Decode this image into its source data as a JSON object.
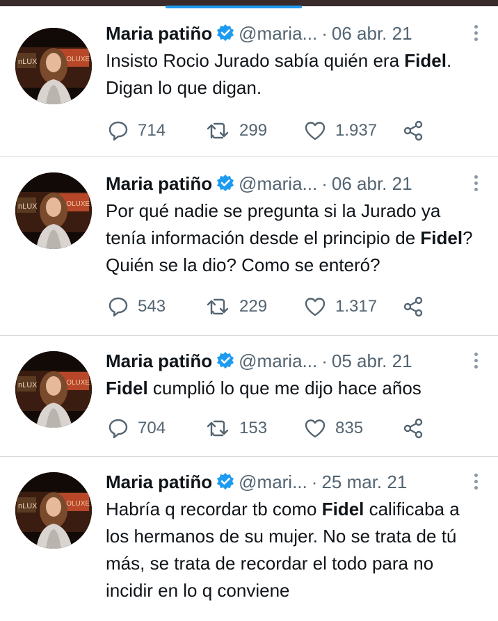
{
  "tweets": [
    {
      "name": "Maria patiño",
      "handle": "@maria...",
      "date": "06 abr. 21",
      "text": [
        {
          "t": "Insisto Rocio Jurado sabía quién era ",
          "b": false
        },
        {
          "t": "Fidel",
          "b": true
        },
        {
          "t": ". Digan lo que digan.",
          "b": false
        }
      ],
      "replies": "714",
      "retweets": "299",
      "likes": "1.937"
    },
    {
      "name": "Maria patiño",
      "handle": "@maria...",
      "date": "06 abr. 21",
      "text": [
        {
          "t": "Por qué nadie se pregunta si la Jurado ya tenía información desde el principio de ",
          "b": false
        },
        {
          "t": "Fidel",
          "b": true
        },
        {
          "t": "? Quién se la dio? Como se enteró?",
          "b": false
        }
      ],
      "replies": "543",
      "retweets": "229",
      "likes": "1.317"
    },
    {
      "name": "Maria patiño",
      "handle": "@maria...",
      "date": "05 abr. 21",
      "text": [
        {
          "t": "Fidel",
          "b": true
        },
        {
          "t": " cumplió lo que me dijo hace años",
          "b": false
        }
      ],
      "replies": "704",
      "retweets": "153",
      "likes": "835"
    },
    {
      "name": "Maria patiño",
      "handle": "@mari...",
      "date": "25 mar. 21",
      "text": [
        {
          "t": "Habría q recordar tb como ",
          "b": false
        },
        {
          "t": "Fidel",
          "b": true
        },
        {
          "t": " calificaba a los hermanos de su mujer. No se trata de tú más, se trata de recordar el todo para no incidir en lo q conviene",
          "b": false
        }
      ],
      "replies": "",
      "retweets": "",
      "likes": ""
    }
  ],
  "icons": {
    "verified": "verified-badge-icon",
    "more": "more-options-icon",
    "reply": "reply-icon",
    "retweet": "retweet-icon",
    "like": "heart-icon",
    "share": "share-icon"
  },
  "colors": {
    "accent": "#1d9bf0",
    "text": "#0f1419",
    "muted": "#536471"
  }
}
